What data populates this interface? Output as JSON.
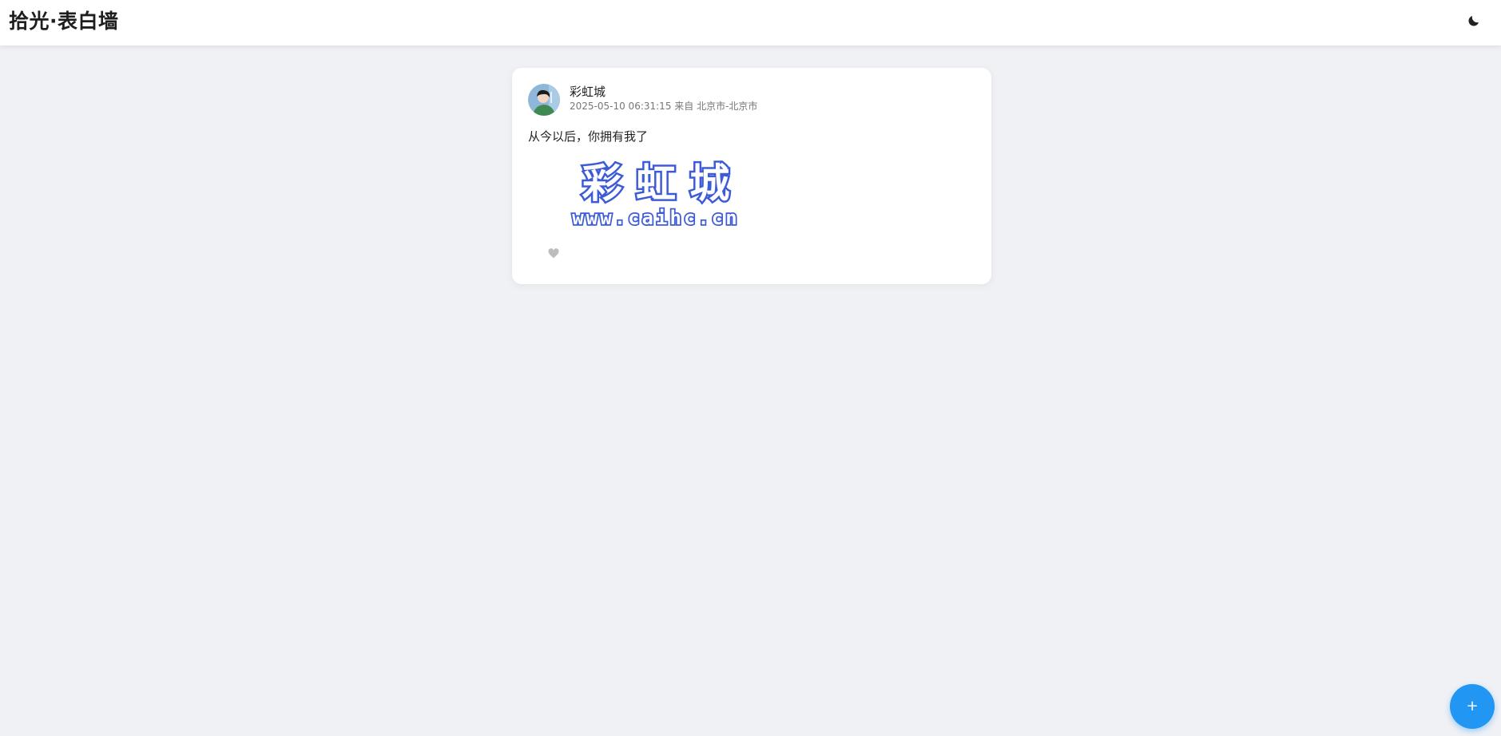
{
  "header": {
    "title": "拾光·表白墙",
    "theme_icon": "moon-icon"
  },
  "post": {
    "author": "彩虹城",
    "meta": "2025-05-10 06:31:15 来自 北京市-北京市",
    "content": "从今以后，你拥有我了",
    "image": {
      "headline": "彩 虹 城",
      "url_text": "www.caihc.cn",
      "color": "#3d5bd6"
    },
    "like_icon": "heart-icon"
  },
  "fab": {
    "label": "+",
    "color": "#2196f3"
  }
}
